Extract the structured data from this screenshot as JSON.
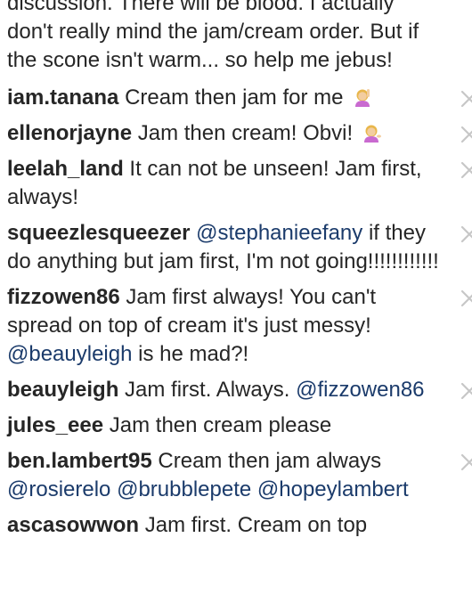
{
  "intro_text": "discussion. There will be blood. I actually don't really mind the jam/cream order. But if the scone isn't warm... so help me jebus!",
  "comments": [
    {
      "username": "iam.tanana",
      "text": "Cream then jam for me"
    },
    {
      "username": "ellenorjayne",
      "text": "Jam then cream! Obvi!"
    },
    {
      "username": "leelah_land",
      "text": "It can not be unseen! Jam first, always!"
    },
    {
      "username": "squeezlesqueezer",
      "mention": "@stephanieefany",
      "text": "if they do anything but jam first, I'm not going!!!!!!!!!!!!"
    },
    {
      "username": "fizzowen86",
      "text": "Jam first always! You can't spread on top of cream it's just messy!",
      "mention": "@beauyleigh",
      "text2": "is he mad?!"
    },
    {
      "username": "beauyleigh",
      "text": "Jam first. Always.",
      "mention": "@fizzowen86"
    },
    {
      "username": "jules_eee",
      "text": "Jam then cream please"
    },
    {
      "username": "ben.lambert95",
      "text": "Cream then jam always",
      "mentions": [
        "@rosierelo",
        "@brubblepete",
        "@hopeylambert"
      ]
    },
    {
      "username": "ascasowwon",
      "text": "Jam first. Cream on top"
    }
  ],
  "icons": {
    "close": "close-icon",
    "emoji_1": "raising-hand-emoji",
    "emoji_2": "tipping-hand-emoji"
  },
  "colors": {
    "text": "#262626",
    "mention": "#1b3b6b",
    "close_icon": "#c7c7c7",
    "skin": "#f3cda0",
    "hair": "#e8b64a",
    "shirt": "#c96ad0"
  }
}
